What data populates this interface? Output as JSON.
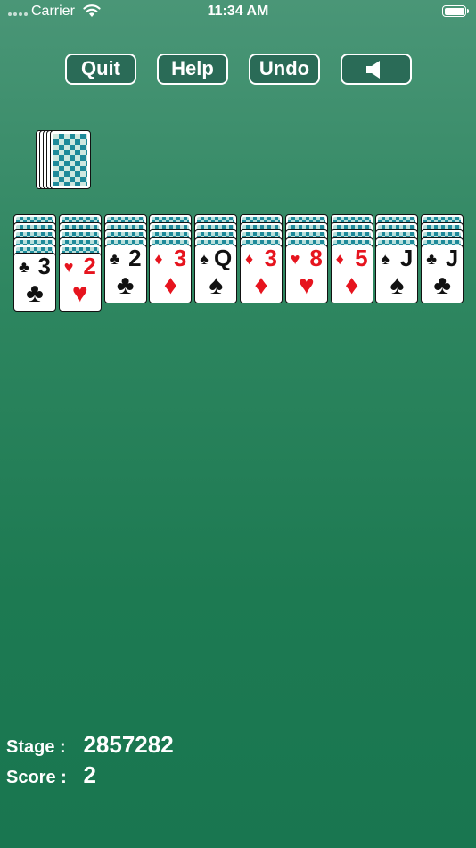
{
  "status_bar": {
    "carrier": "Carrier",
    "time": "11:34 AM"
  },
  "toolbar": {
    "quit_label": "Quit",
    "help_label": "Help",
    "undo_label": "Undo",
    "sound_icon": "speaker-icon"
  },
  "stock": {
    "remaining_piles": 5
  },
  "colors": {
    "felt_top": "#4a9677",
    "felt_bottom": "#197650",
    "card_back": "#1e8a9a",
    "red_suit": "#e6141e",
    "button_fill": "#2a6b57"
  },
  "tableau": [
    {
      "hidden": 5,
      "rank": "3",
      "suit": "♣",
      "color": "black"
    },
    {
      "hidden": 5,
      "rank": "2",
      "suit": "♥",
      "color": "red"
    },
    {
      "hidden": 4,
      "rank": "2",
      "suit": "♣",
      "color": "black"
    },
    {
      "hidden": 4,
      "rank": "3",
      "suit": "♦",
      "color": "red"
    },
    {
      "hidden": 4,
      "rank": "Q",
      "suit": "♠",
      "color": "black"
    },
    {
      "hidden": 4,
      "rank": "3",
      "suit": "♦",
      "color": "red"
    },
    {
      "hidden": 4,
      "rank": "8",
      "suit": "♥",
      "color": "red"
    },
    {
      "hidden": 4,
      "rank": "5",
      "suit": "♦",
      "color": "red"
    },
    {
      "hidden": 4,
      "rank": "J",
      "suit": "♠",
      "color": "black"
    },
    {
      "hidden": 4,
      "rank": "J",
      "suit": "♣",
      "color": "black"
    }
  ],
  "stats": {
    "stage_label": "Stage :",
    "stage_value": "2857282",
    "score_label": "Score :",
    "score_value": "2"
  }
}
